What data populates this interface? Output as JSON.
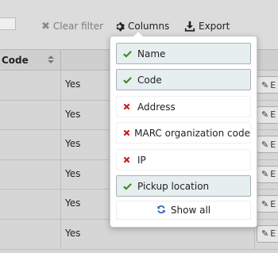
{
  "toolbar": {
    "clear_filter_label": "Clear filter",
    "columns_label": "Columns",
    "export_label": "Export"
  },
  "table": {
    "header_code": "Code",
    "rows": [
      {
        "value": "Yes",
        "action": "E"
      },
      {
        "value": "Yes",
        "action": "E"
      },
      {
        "value": "Yes",
        "action": "E"
      },
      {
        "value": "Yes",
        "action": "E"
      },
      {
        "value": "Yes",
        "action": "E"
      },
      {
        "value": "Yes",
        "action": "E"
      }
    ]
  },
  "columns_menu": {
    "items": [
      {
        "label": "Name",
        "selected": true
      },
      {
        "label": "Code",
        "selected": true
      },
      {
        "label": "Address",
        "selected": false
      },
      {
        "label": "MARC organization code",
        "selected": false
      },
      {
        "label": "IP",
        "selected": false
      },
      {
        "label": "Pickup location",
        "selected": true
      }
    ],
    "show_all_label": "Show all"
  },
  "colors": {
    "check": "#3c8c2c",
    "cross": "#cc1a1a",
    "refresh": "#2a5fb0",
    "selected_bg": "#e6eeef"
  }
}
